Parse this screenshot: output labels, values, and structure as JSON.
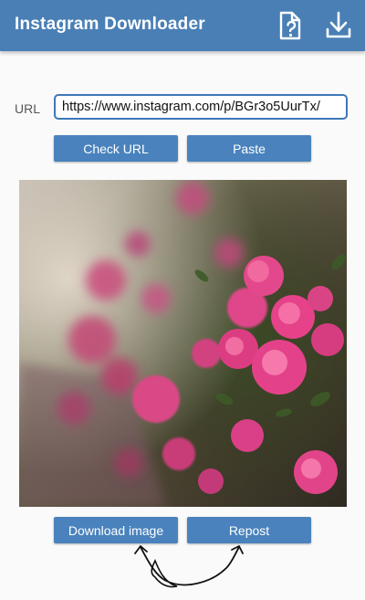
{
  "app_bar": {
    "title": "Instagram Downloader",
    "background": "#4a7fb5",
    "icons": [
      "help-document-icon",
      "download-icon"
    ]
  },
  "url_section": {
    "label": "URL",
    "value": "https://www.instagram.com/p/BGr3o5UurTx/",
    "border_color": "#3d78b8"
  },
  "buttons": {
    "check_url": "Check URL",
    "paste": "Paste",
    "download_image": "Download image",
    "repost": "Repost",
    "color": "#4a82bd"
  },
  "preview": {
    "subject": "pink-roses-bush-photo"
  }
}
